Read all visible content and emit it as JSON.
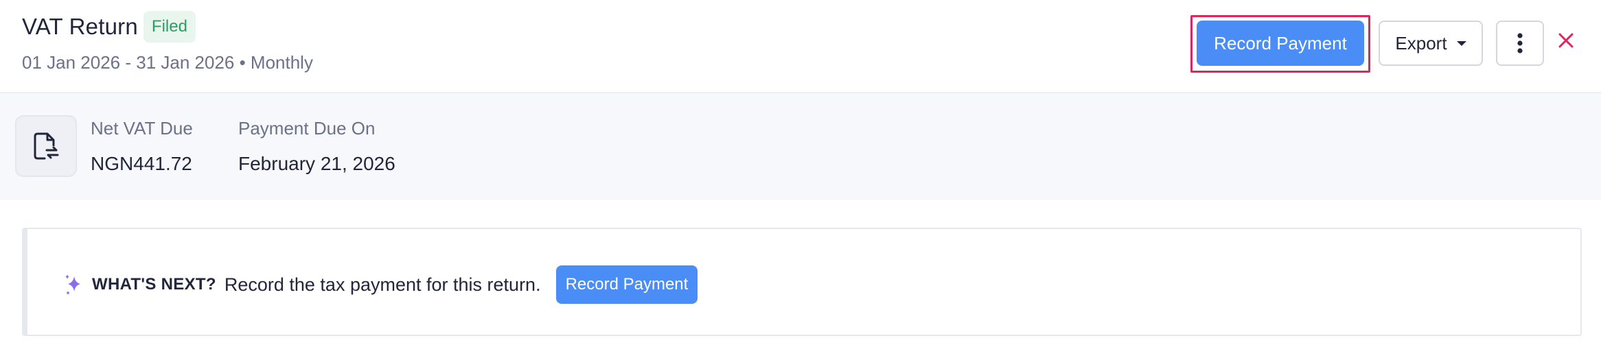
{
  "header": {
    "title": "VAT Return",
    "status": "Filed",
    "period": "01 Jan 2026 - 31 Jan 2026 • Monthly",
    "record_payment_label": "Record Payment",
    "export_label": "Export"
  },
  "summary": {
    "net_vat_label": "Net VAT Due",
    "net_vat_value": "NGN441.72",
    "due_on_label": "Payment Due On",
    "due_on_value": "February 21, 2026"
  },
  "whats_next": {
    "heading": "WHAT'S NEXT?",
    "text": "Record the tax payment for this return.",
    "button_label": "Record Payment"
  },
  "colors": {
    "primary": "#4a8df6",
    "filed_badge_bg": "#e8f6ee",
    "filed_badge_text": "#2e9c61",
    "close": "#e0245e",
    "highlight": "#e0245e"
  },
  "icons": [
    "document-exchange-icon",
    "caret-down-icon",
    "kebab-menu-icon",
    "close-icon",
    "sparkle-icon"
  ]
}
